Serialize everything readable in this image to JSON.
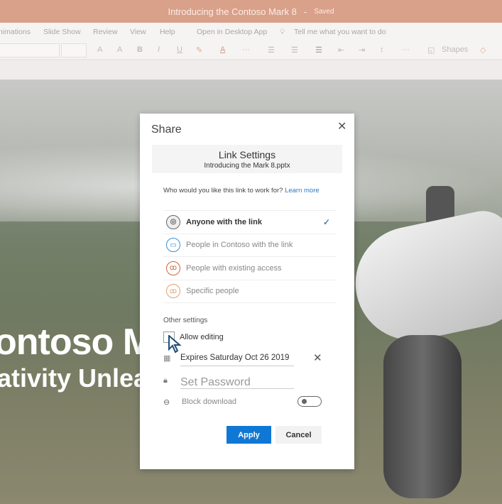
{
  "titlebar": {
    "title": "Introducing the Contoso Mark 8",
    "separator": "-",
    "status": "Saved"
  },
  "menu": [
    "nimations",
    "Slide Show",
    "Review",
    "View",
    "Help",
    "Open in Desktop App",
    "Tell me what you want to do"
  ],
  "toolbar": {
    "grow": "A",
    "shrink": "A",
    "bold": "B",
    "italic": "I",
    "underline": "U",
    "more1": "···",
    "more2": "···",
    "shapes": "Shapes"
  },
  "slide": {
    "title": "ontoso Ma",
    "subtitle": "ativity Unlea"
  },
  "dialog": {
    "title": "Share",
    "close": "✕",
    "header": "Link Settings",
    "filename": "Introducing the Mark 8.pptx",
    "question": "Who would you like this link to work for?",
    "learn_more": "Learn more",
    "options": [
      {
        "label": "Anyone with the link",
        "icon": "globe-icon",
        "selected": true,
        "color": "#666666"
      },
      {
        "label": "People in Contoso with the link",
        "icon": "briefcase-icon",
        "selected": false,
        "color": "#3b8ed0"
      },
      {
        "label": "People with existing access",
        "icon": "people-icon",
        "selected": false,
        "color": "#c8683b"
      },
      {
        "label": "Specific people",
        "icon": "add-people-icon",
        "selected": false,
        "color": "#e0a070"
      }
    ],
    "check": "✓",
    "other_settings": "Other settings",
    "allow_editing": "Allow editing",
    "expires": "Expires Saturday Oct 26 2019",
    "password_placeholder": "Set Password",
    "block_download": "Block download",
    "apply": "Apply",
    "cancel": "Cancel"
  }
}
